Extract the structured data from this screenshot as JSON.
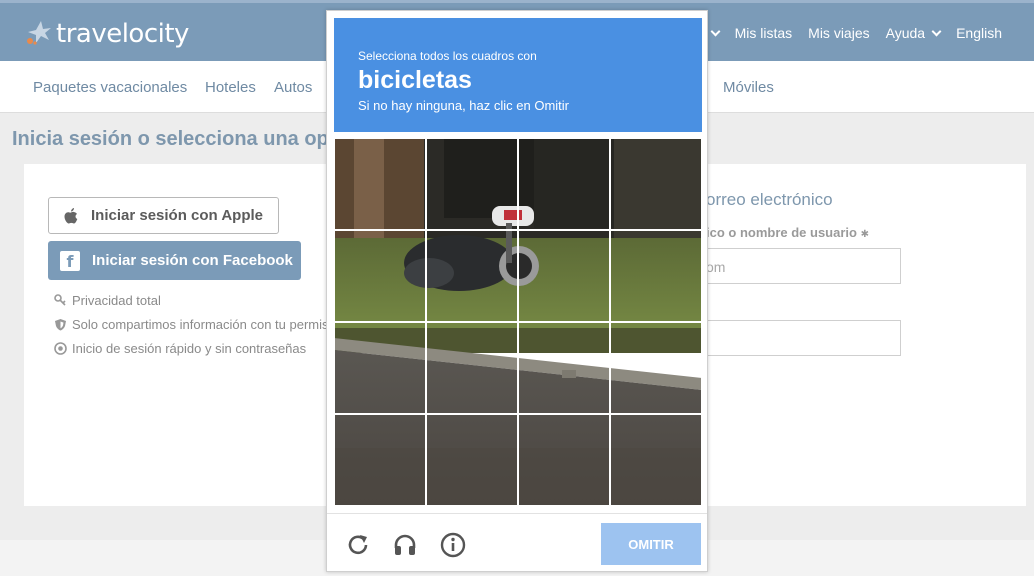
{
  "header": {
    "logo_text": "travelocity",
    "logo_trademark": "·",
    "nav": [
      "Mis listas",
      "Mis viajes",
      "Ayuda",
      "English"
    ]
  },
  "subnav": {
    "items": [
      "Paquetes vacacionales",
      "Hoteles",
      "Autos",
      "Móviles"
    ]
  },
  "page": {
    "title": "Inicia sesión o selecciona una op",
    "apple_button": "Iniciar sesión con Apple",
    "facebook_button": "Iniciar sesión con Facebook",
    "features": [
      "Privacidad total",
      "Solo compartimos información con tu permis",
      "Inicio de sesión rápido y sin contraseñas"
    ],
    "email_heading": "orreo electrónico",
    "username_label": "ico o nombre de usuario",
    "required_mark": "✱",
    "email_value": "om"
  },
  "captcha": {
    "instruction_line1": "Selecciona todos los cuadros con",
    "target": "bicicletas",
    "instruction_line2": "Si no hay ninguna, haz clic en Omitir",
    "skip_button": "OMITIR",
    "colors": {
      "header": "#4a90e2",
      "skip": "#9dc3f0"
    },
    "icons": [
      "reload-icon",
      "audio-icon",
      "info-icon"
    ]
  },
  "colors": {
    "brand": "#7b9bb8",
    "title": "#7e97ad"
  }
}
